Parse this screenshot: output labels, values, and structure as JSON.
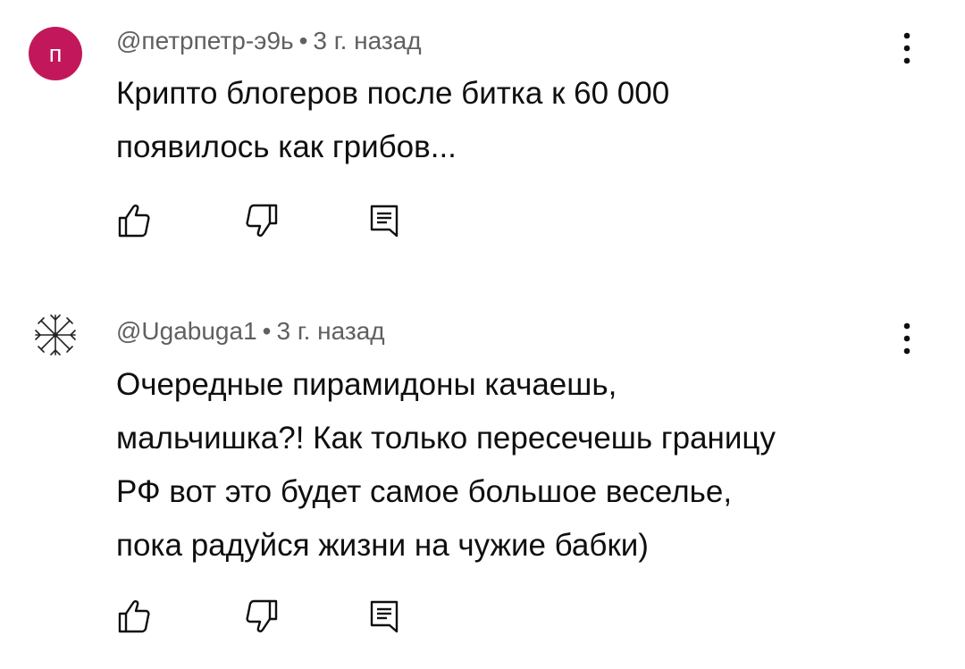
{
  "comments": [
    {
      "avatar_letter": "п",
      "avatar_color": "#c2185b",
      "author": "@петрпетр-э9ь",
      "separator": "•",
      "time": "3 г. назад",
      "text_lines": [
        "Крипто блогеров после битка к 60 000",
        "появилось как грибов..."
      ],
      "icons": [
        "like-icon",
        "dislike-icon",
        "reply-icon",
        "more-vert-icon"
      ]
    },
    {
      "avatar_symbol": "vegvisir-icon",
      "author": "@Ugabuga1",
      "separator": "•",
      "time": "3 г. назад",
      "text_lines": [
        "Очередные пирамидоны качаешь,",
        "мальчишка?! Как только пересечешь границу",
        "РФ вот это будет самое большое веселье,",
        "пока радуйся жизни на чужие бабки)"
      ],
      "icons": [
        "like-icon",
        "dislike-icon",
        "reply-icon",
        "more-vert-icon"
      ]
    }
  ]
}
